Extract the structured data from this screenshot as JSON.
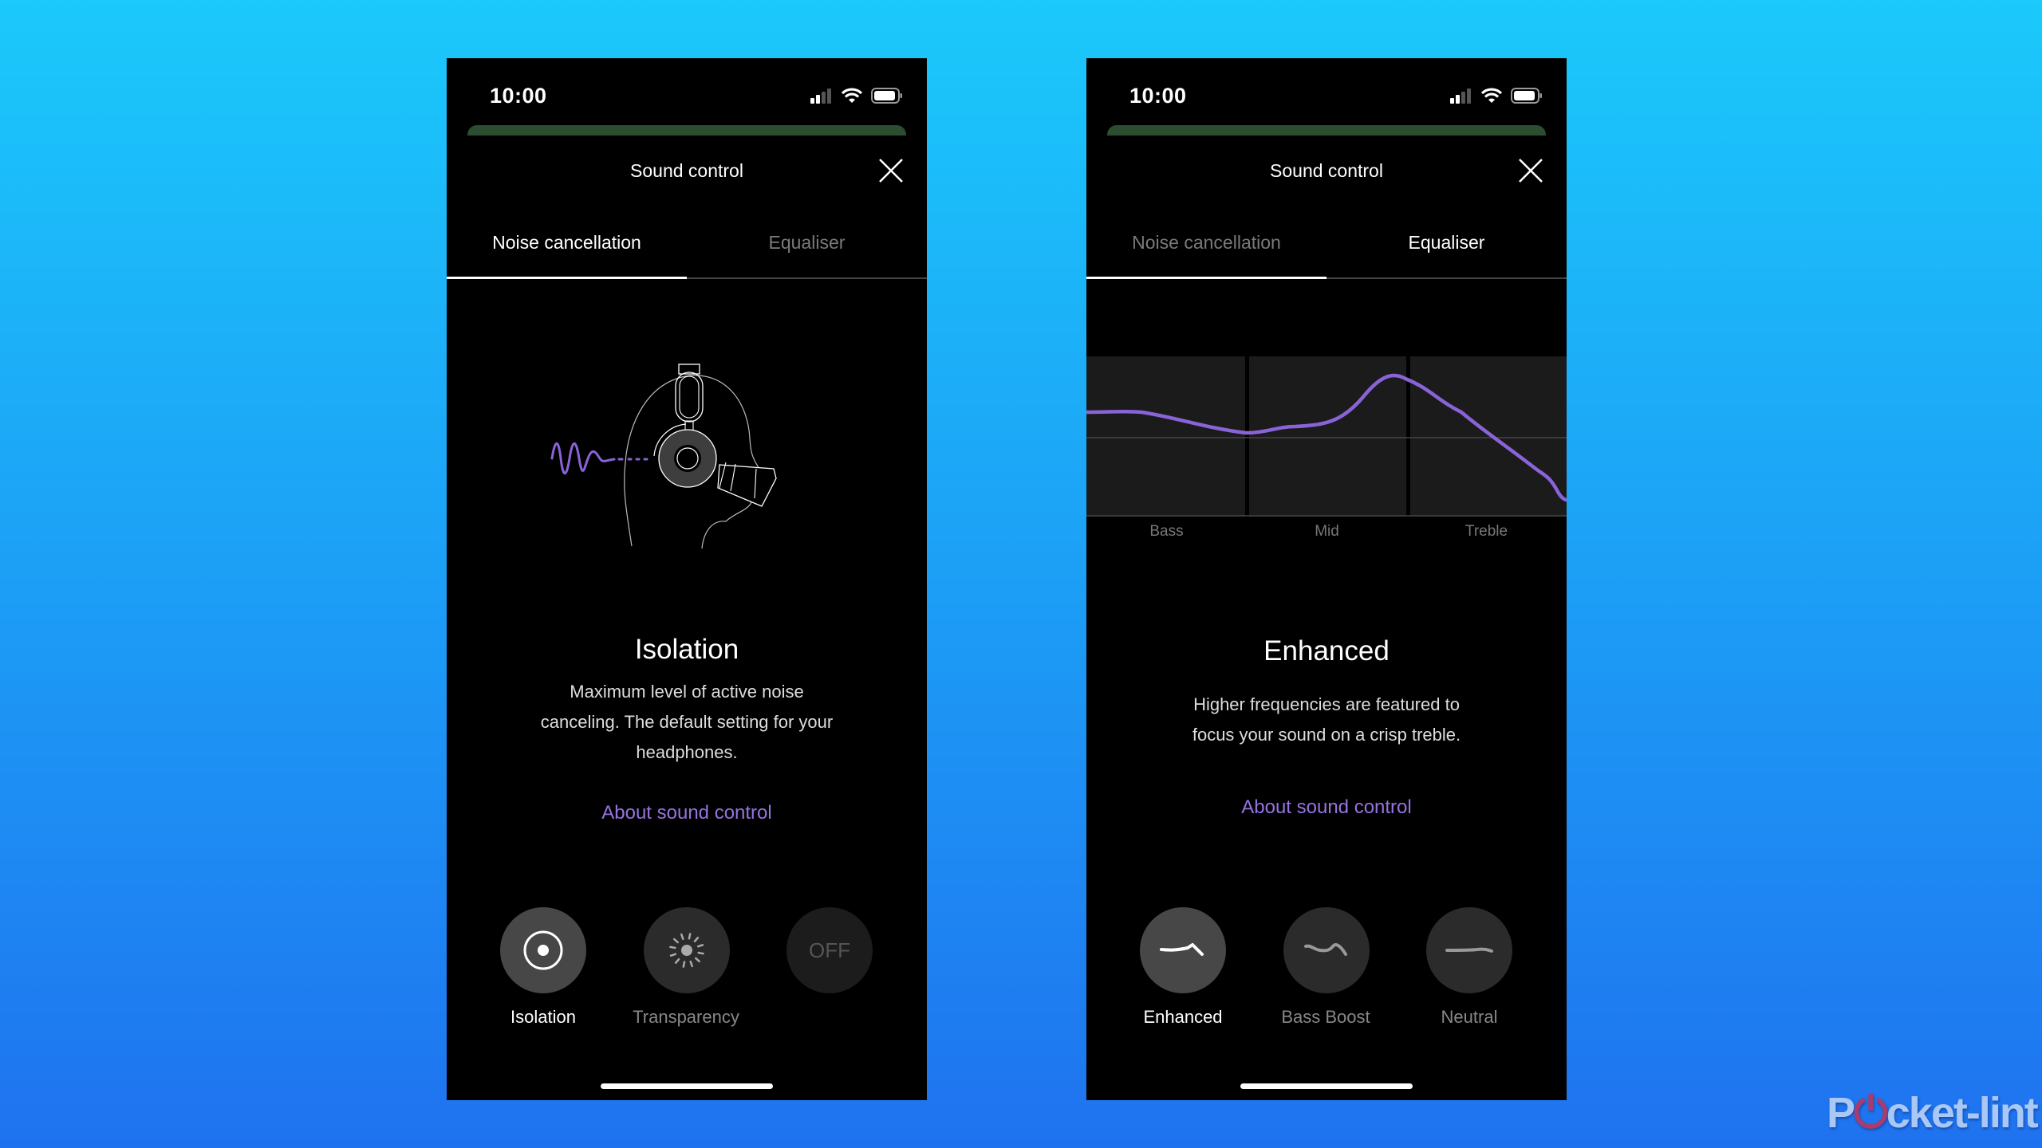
{
  "status_bar": {
    "time": "10:00"
  },
  "screens": [
    {
      "title": "Sound control",
      "tabs": [
        {
          "label": "Noise cancellation",
          "active": true
        },
        {
          "label": "Equaliser",
          "active": false
        }
      ],
      "mode_title": "Isolation",
      "description": [
        "Maximum level of active noise",
        "canceling. The default setting for your",
        "headphones."
      ],
      "link": "About sound control",
      "options": [
        {
          "label": "Isolation",
          "icon": "isolation-icon",
          "selected": true
        },
        {
          "label": "Transparency",
          "icon": "transparency-icon",
          "selected": false
        },
        {
          "label": "",
          "icon_text": "OFF",
          "selected": false
        }
      ]
    },
    {
      "title": "Sound control",
      "tabs": [
        {
          "label": "Noise cancellation",
          "active": false
        },
        {
          "label": "Equaliser",
          "active": true
        }
      ],
      "eq_labels": [
        "Bass",
        "Mid",
        "Treble"
      ],
      "mode_title": "Enhanced",
      "description": [
        "Higher frequencies are featured to",
        "focus your sound on a crisp treble."
      ],
      "link": "About sound control",
      "options": [
        {
          "label": "Enhanced",
          "icon": "eq-enhanced-icon",
          "selected": true
        },
        {
          "label": "Bass Boost",
          "icon": "eq-bass-boost-icon",
          "selected": false
        },
        {
          "label": "Neutral",
          "icon": "eq-neutral-icon",
          "selected": false
        }
      ]
    }
  ],
  "colors": {
    "accent": "#9574e0",
    "eq_curve": "#8a63d8",
    "background_top": "#1bc9fb",
    "background_bottom": "#1f72ef"
  },
  "watermark": "Pocket-lint"
}
